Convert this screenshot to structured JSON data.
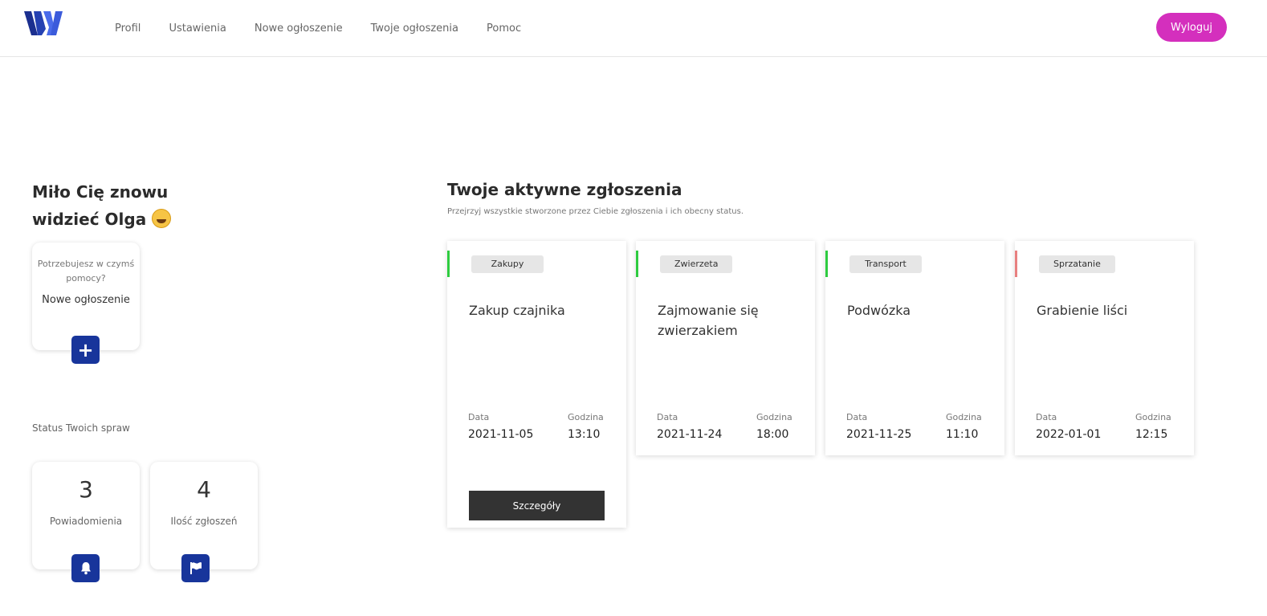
{
  "header": {
    "nav": [
      "Profil",
      "Ustawienia",
      "Nowe ogłoszenie",
      "Twoje ogłoszenia",
      "Pomoc"
    ],
    "logout": "Wyloguj",
    "brand_colors": {
      "logo_dark": "#1b2f8f",
      "logo_light": "#4a6bea",
      "logout_bg": "#d42fbd"
    }
  },
  "greeting": {
    "line1": "Miło Cię znowu",
    "line2": "widzieć Olga"
  },
  "help_card": {
    "question": "Potrzebujesz w czymś pomocy?",
    "title": "Nowe ogłoszenie",
    "icon": "plus-icon"
  },
  "status": {
    "label": "Status Twoich spraw",
    "cards": [
      {
        "value": "3",
        "label": "Powiadomienia",
        "icon": "bell-icon"
      },
      {
        "value": "4",
        "label": "Ilość zgłoszeń",
        "icon": "flag-icon"
      }
    ]
  },
  "requests": {
    "title": "Twoje aktywne zgłoszenia",
    "subtitle": "Przejrzyj wszystkie stworzone przez Ciebie zgłoszenia i ich obecny status.",
    "date_label": "Data",
    "time_label": "Godzina",
    "details_label": "Szczegóły",
    "items": [
      {
        "category": "Zakupy",
        "title": "Zakup czajnika",
        "date": "2021-11-05",
        "time": "13:10",
        "status_color": "#2ecc40"
      },
      {
        "category": "Zwierzeta",
        "title": "Zajmowanie się zwierzakiem",
        "date": "2021-11-24",
        "time": "18:00",
        "status_color": "#2ecc40"
      },
      {
        "category": "Transport",
        "title": "Podwózka",
        "date": "2021-11-25",
        "time": "11:10",
        "status_color": "#2ecc40"
      },
      {
        "category": "Sprzatanie",
        "title": "Grabienie liści",
        "date": "2022-01-01",
        "time": "12:15",
        "status_color": "#e88080"
      }
    ]
  }
}
